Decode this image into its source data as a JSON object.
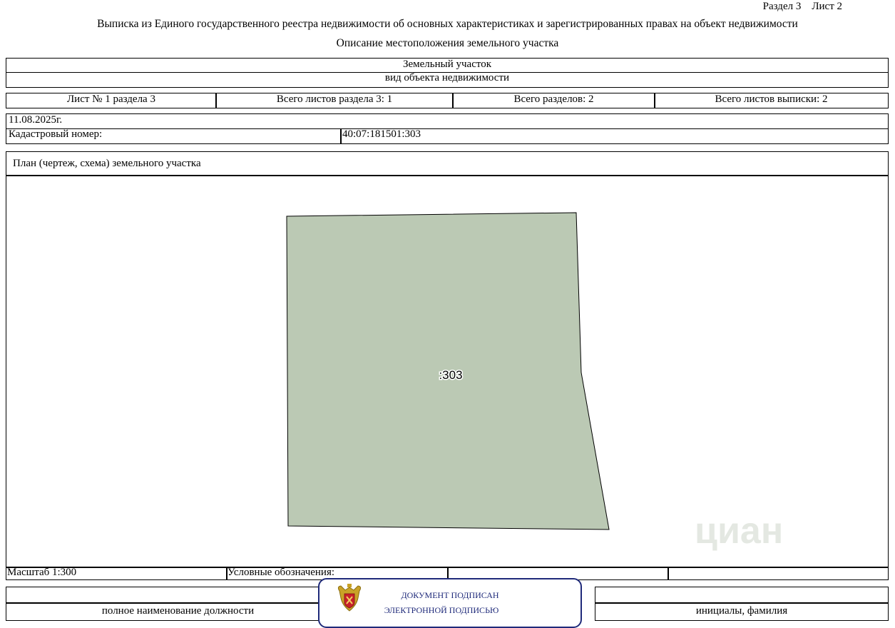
{
  "header": {
    "section_sheet": "Раздел 3    Лист 2",
    "title": "Выписка из Единого государственного реестра недвижимости об основных характеристиках и зарегистрированных правах на объект недвижимости",
    "subtitle": "Описание местоположения земельного участка"
  },
  "object": {
    "type": "Земельный участок",
    "type_caption": "вид объекта недвижимости"
  },
  "sheets": {
    "sheet_no": "Лист № 1 раздела 3",
    "total_section_sheets": "Всего листов раздела 3: 1",
    "total_sections": "Всего разделов: 2",
    "total_extract_sheets": "Всего листов выписки: 2"
  },
  "date": "11.08.2025г.",
  "cadastral": {
    "label": "Кадастровый номер:",
    "value": "40:07:181501:303"
  },
  "plan": {
    "title": "План (чертеж, схема) земельного участка",
    "parcel_label": ":303",
    "parcel_fill": "#bbc9b4",
    "watermark": "циан"
  },
  "legend": {
    "scale": "Масштаб 1:300",
    "legend_label": "Условные обозначения:"
  },
  "signature": {
    "position_caption": "полное наименование должности",
    "stamp_line1": "ДОКУМЕНТ ПОДПИСАН",
    "stamp_line2": "ЭЛЕКТРОННОЙ ПОДПИСЬЮ",
    "initials_caption": "инициалы, фамилия",
    "stamp_color": "#1f2a7a"
  }
}
